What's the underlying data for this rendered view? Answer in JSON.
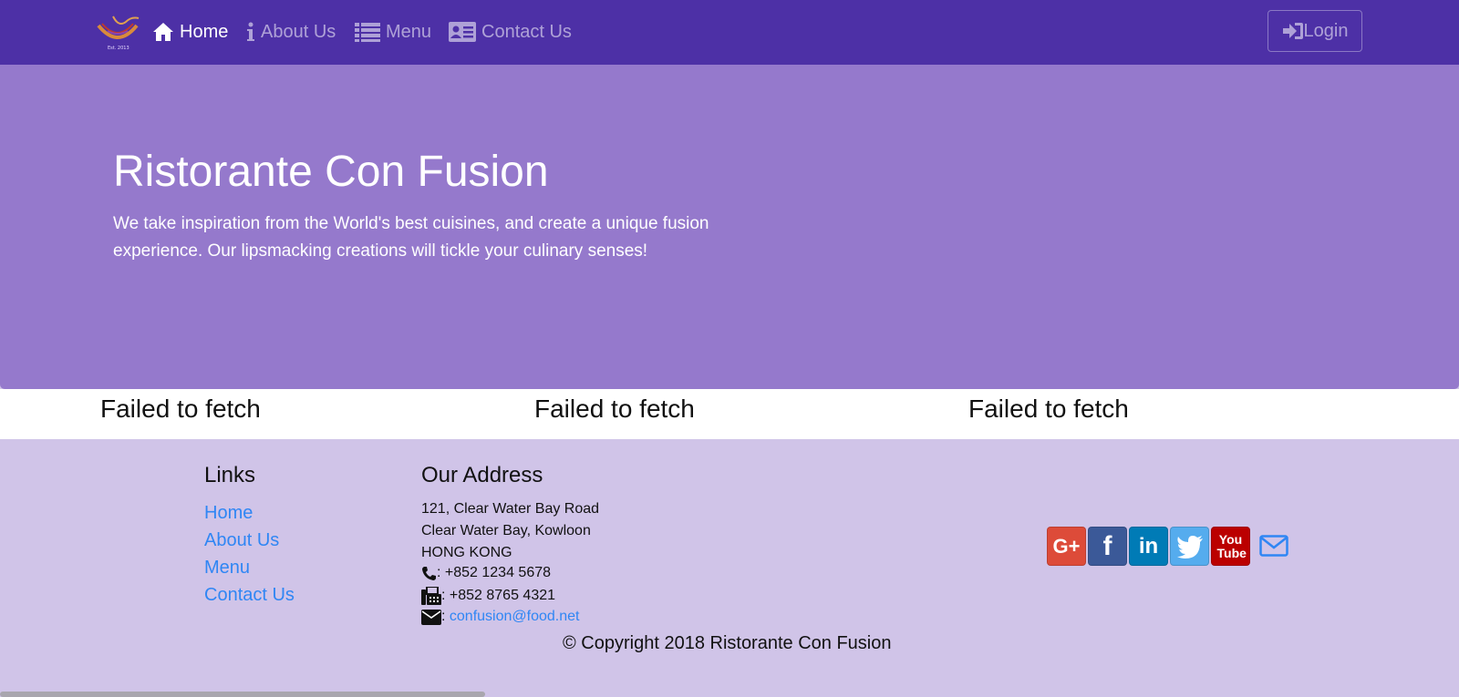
{
  "navbar": {
    "items": [
      {
        "label": "Home",
        "icon": "home-icon"
      },
      {
        "label": "About Us",
        "icon": "info-icon"
      },
      {
        "label": "Menu",
        "icon": "list-icon"
      },
      {
        "label": "Contact Us",
        "icon": "address-card-icon"
      }
    ],
    "login_label": "Login",
    "login_icon": "sign-in-icon",
    "logo_text": "Est. 2013"
  },
  "jumbotron": {
    "title": "Ristorante Con Fusion",
    "text": "We take inspiration from the World's best cuisines, and create a unique fusion experience. Our lipsmacking creations will tickle your culinary senses!"
  },
  "fetch_errors": [
    "Failed to fetch",
    "Failed to fetch",
    "Failed to fetch"
  ],
  "footer": {
    "links_heading": "Links",
    "links": [
      "Home",
      "About Us",
      "Menu",
      "Contact Us"
    ],
    "address_heading": "Our Address",
    "address": [
      "121, Clear Water Bay Road",
      "Clear Water Bay, Kowloon",
      "HONG KONG"
    ],
    "phone": ": +852 1234 5678",
    "fax": ": +852 8765 4321",
    "email_sep": ": ",
    "email": "confusion@food.net",
    "socials": [
      {
        "name": "google-plus",
        "text": "G+",
        "color": "#dd4b39"
      },
      {
        "name": "facebook",
        "text": "f",
        "color": "#3b5998"
      },
      {
        "name": "linkedin",
        "text": "in",
        "color": "#007bb6"
      },
      {
        "name": "twitter",
        "text": "",
        "color": "#55acee"
      },
      {
        "name": "youtube",
        "text": "You Tube",
        "color": "#bb0000"
      }
    ],
    "copyright": "© Copyright 2018 Ristorante Con Fusion"
  },
  "colors": {
    "navbar": "#4d30a6",
    "jumbotron": "#9579cc",
    "footer": "#d0c4e8",
    "link": "#2f86f4"
  }
}
